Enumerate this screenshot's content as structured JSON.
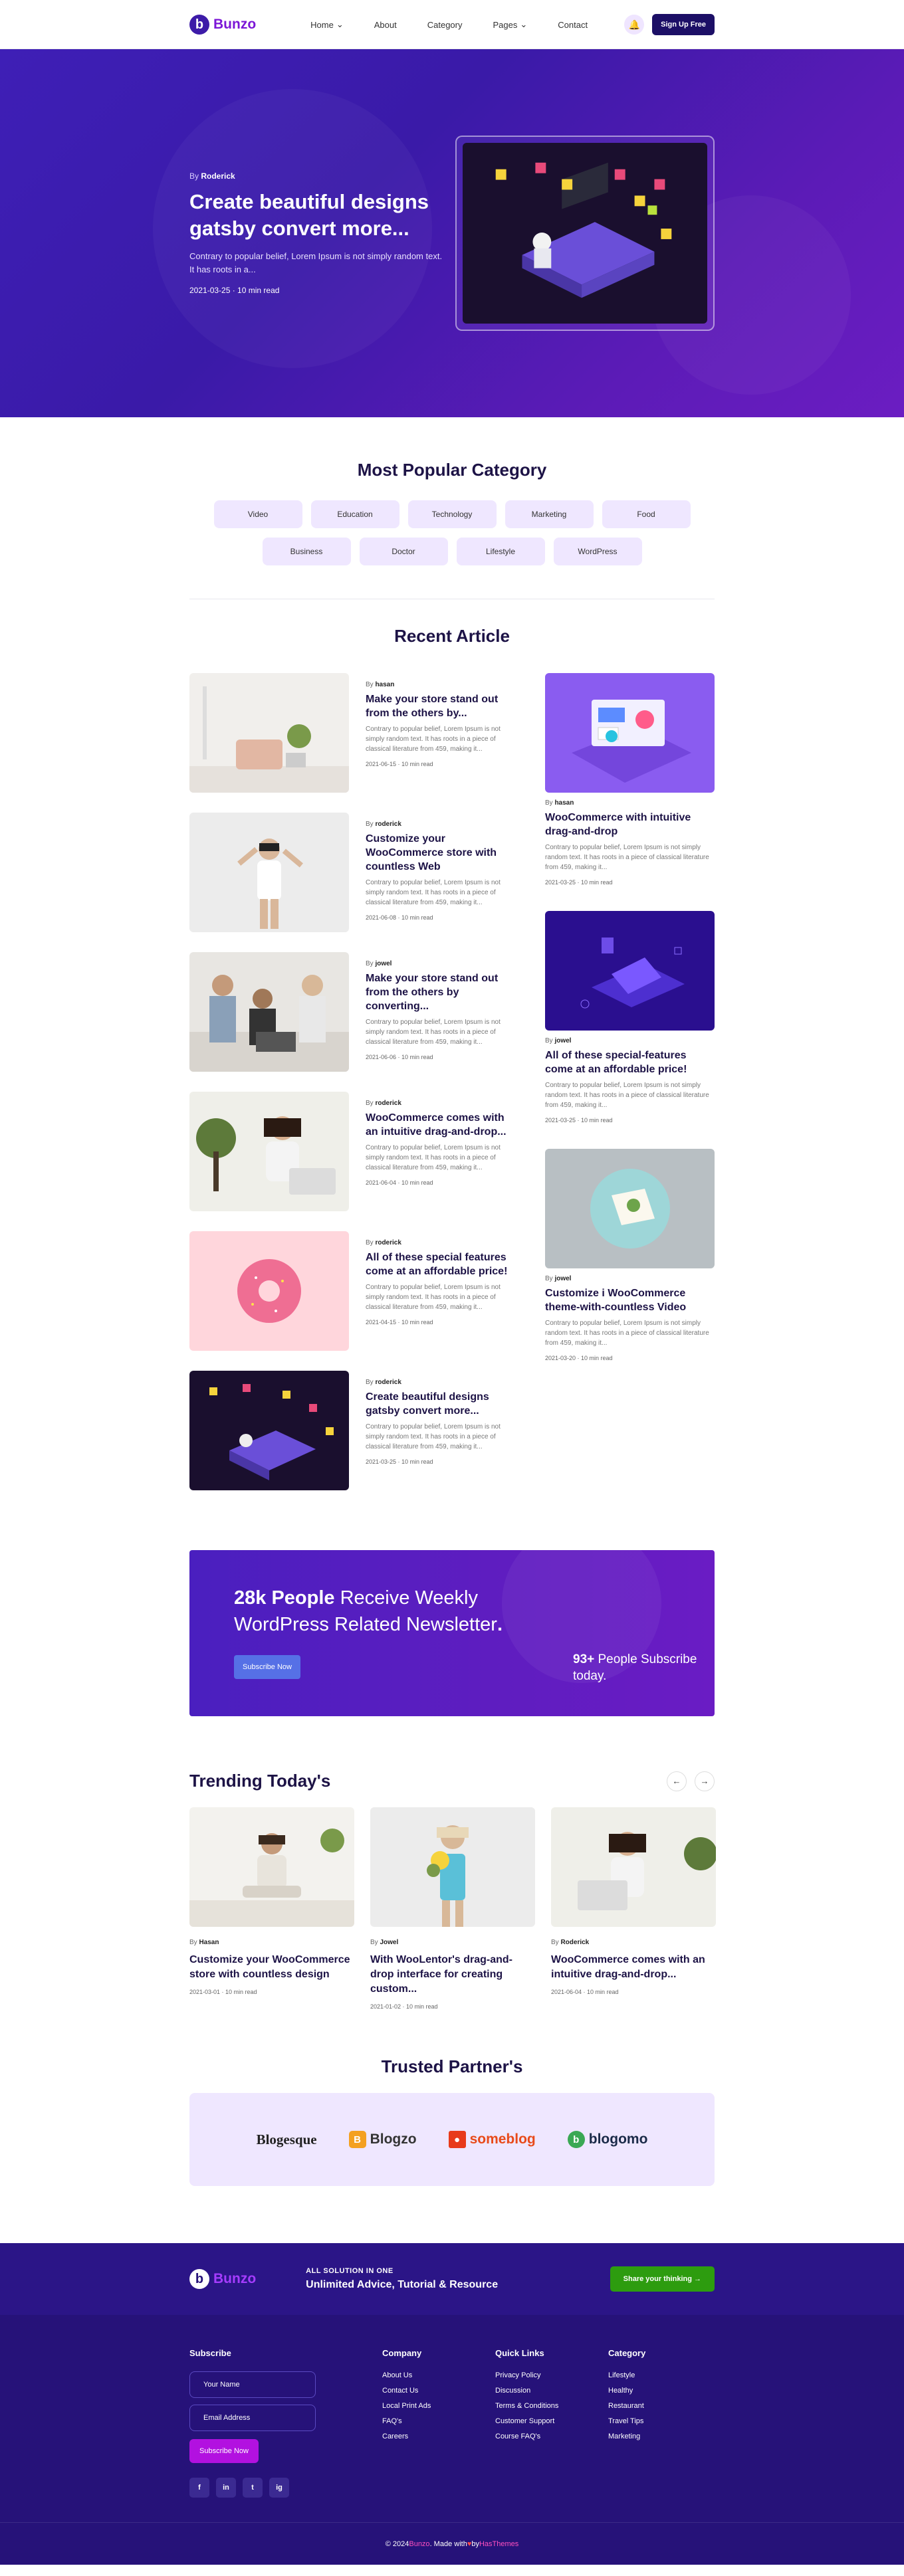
{
  "header": {
    "logo_mark": "b",
    "logo_text": "Bunzo",
    "nav": [
      "Home",
      "About",
      "Category",
      "Pages",
      "Contact"
    ],
    "bell_icon": "bell-icon",
    "signup_label": "Sign Up Free"
  },
  "hero": {
    "by_prefix": "By",
    "author": "Roderick",
    "title": "Create beautiful designs gatsby convert more...",
    "desc": "Contrary to popular belief, Lorem Ipsum is not simply random text. It has roots in a...",
    "meta": "2021-03-25 · 10 min read"
  },
  "categories": {
    "title": "Most Popular Category",
    "items": [
      "Video",
      "Education",
      "Technology",
      "Marketing",
      "Food",
      "Business",
      "Doctor",
      "Lifestyle",
      "WordPress"
    ]
  },
  "recent": {
    "title": "Recent Article",
    "left": [
      {
        "author": "hasan",
        "title": "Make your store stand out from the others by...",
        "desc": "Contrary to popular belief, Lorem Ipsum is not simply random text. It has roots in a piece of classical literature from 459, making it...",
        "meta": "2021-06-15 · 10 min read"
      },
      {
        "author": "roderick",
        "title": "Customize your WooCommerce store with countless Web",
        "desc": "Contrary to popular belief, Lorem Ipsum is not simply random text. It has roots in a piece of classical literature from 459, making it...",
        "meta": "2021-06-08 · 10 min read"
      },
      {
        "author": "jowel",
        "title": "Make your store stand out from the others by converting...",
        "desc": "Contrary to popular belief, Lorem Ipsum is not simply random text. It has roots in a piece of classical literature from 459, making it...",
        "meta": "2021-06-06 · 10 min read"
      },
      {
        "author": "roderick",
        "title": "WooCommerce comes with an intuitive drag-and-drop...",
        "desc": "Contrary to popular belief, Lorem Ipsum is not simply random text. It has roots in a piece of classical literature from 459, making it...",
        "meta": "2021-06-04 · 10 min read"
      },
      {
        "author": "roderick",
        "title": "All of these special features come at an affordable price!",
        "desc": "Contrary to popular belief, Lorem Ipsum is not simply random text. It has roots in a piece of classical literature from 459, making it...",
        "meta": "2021-04-15 · 10 min read"
      },
      {
        "author": "roderick",
        "title": "Create beautiful designs gatsby convert more...",
        "desc": "Contrary to popular belief, Lorem Ipsum is not simply random text. It has roots in a piece of classical literature from 459, making it...",
        "meta": "2021-03-25 · 10 min read"
      }
    ],
    "right": [
      {
        "author": "hasan",
        "title": "WooCommerce with intuitive drag-and-drop",
        "desc": "Contrary to popular belief, Lorem Ipsum is not simply random text. It has roots in a piece of classical literature from 459, making it...",
        "meta": "2021-03-25 · 10 min read"
      },
      {
        "author": "jowel",
        "title": "All of these special-features come at an affordable price!",
        "desc": "Contrary to popular belief, Lorem Ipsum is not simply random text. It has roots in a piece of classical literature from 459, making it...",
        "meta": "2021-03-25 · 10 min read"
      },
      {
        "author": "jowel",
        "title": "Customize i WooCommerce theme-with-countless Video",
        "desc": "Contrary to popular belief, Lorem Ipsum is not simply random text. It has roots in a piece of classical literature from 459, making it...",
        "meta": "2021-03-20 · 10 min read"
      }
    ]
  },
  "newsletter": {
    "bold": "28k People",
    "rest": " Receive Weekly WordPress Related Newsletter",
    "dot": ".",
    "button": "Subscribe Now",
    "count_bold": "93+",
    "count_rest": " People Subscribe today."
  },
  "trending": {
    "title": "Trending Today's",
    "prev": "←",
    "next": "→",
    "items": [
      {
        "author": "Hasan",
        "title": "Customize your WooCommerce store with countless design",
        "meta": "2021-03-01 · 10 min read"
      },
      {
        "author": "Jowel",
        "title": "With WooLentor's drag-and-drop interface for creating custom...",
        "meta": "2021-01-02 · 10 min read"
      },
      {
        "author": "Roderick",
        "title": "WooCommerce comes with an intuitive drag-and-drop...",
        "meta": "2021-06-04 · 10 min read"
      }
    ]
  },
  "partners": {
    "title": "Trusted Partner's",
    "items": [
      "Blogesque",
      "Blogzo",
      "someblog",
      "blogomo"
    ]
  },
  "footer": {
    "logo_mark": "b",
    "logo_text": "Bunzo",
    "small": "ALL SOLUTION IN ONE",
    "big": "Unlimited Advice, Tutorial & Resource",
    "share": "Share your thinking →",
    "subscribe_title": "Subscribe",
    "name_ph": "Your Name",
    "email_ph": "Email Address",
    "sub_btn": "Subscribe Now",
    "socials": [
      "f",
      "in",
      "t",
      "ig"
    ],
    "company_title": "Company",
    "company": [
      "About Us",
      "Contact Us",
      "Local Print Ads",
      "FAQ's",
      "Careers"
    ],
    "quick_title": "Quick Links",
    "quick": [
      "Privacy Policy",
      "Discussion",
      "Terms & Conditions",
      "Customer Support",
      "Course FAQ's"
    ],
    "cat_title": "Category",
    "cats": [
      "Lifestyle",
      "Healthy",
      "Restaurant",
      "Travel Tips",
      "Marketing"
    ],
    "copy_pre": "© 2024 ",
    "copy_brand": "Bunzo",
    "copy_mid": ". Made with ",
    "copy_heart": "♥",
    "copy_by": " by ",
    "copy_author": "HasThemes"
  },
  "colors": {
    "primary": "#3e1fb6",
    "accent": "#7b16d6",
    "dark": "#1d1346",
    "footer": "#261279"
  }
}
